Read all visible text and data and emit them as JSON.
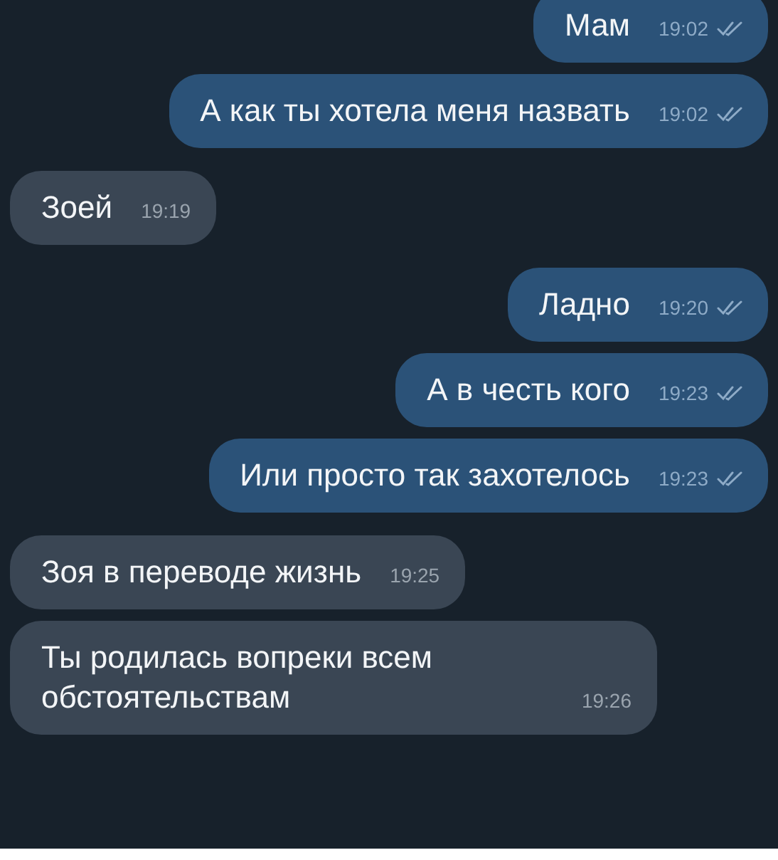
{
  "messages": [
    {
      "kind": "out",
      "text": "Мам",
      "time": "19:02",
      "read": true
    },
    {
      "kind": "out",
      "text": "А как ты хотела меня назвать",
      "time": "19:02",
      "read": true
    },
    {
      "kind": "in",
      "text": "Зоей",
      "time": "19:19"
    },
    {
      "kind": "out",
      "text": "Ладно",
      "time": "19:20",
      "read": true
    },
    {
      "kind": "out",
      "text": "А в честь кого",
      "time": "19:23",
      "read": true
    },
    {
      "kind": "out",
      "text": "Или просто так захотелось",
      "time": "19:23",
      "read": true
    },
    {
      "kind": "in",
      "text": "Зоя в переводе жизнь",
      "time": "19:25"
    },
    {
      "kind": "in",
      "text": "Ты родилась вопреки всем обстоятельствам",
      "time": "19:26"
    }
  ]
}
